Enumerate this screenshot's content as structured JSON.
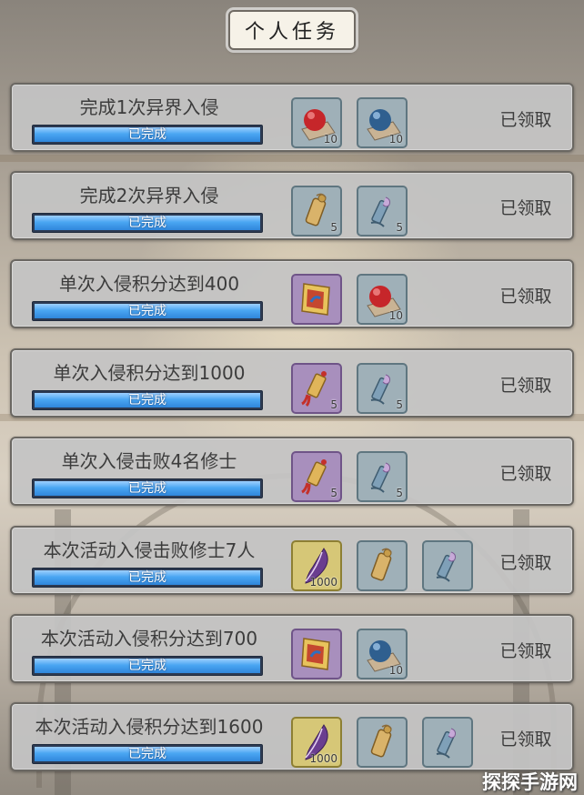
{
  "header": {
    "title": "个人任务"
  },
  "tasks": [
    {
      "title": "完成1次异界入侵",
      "progress_label": "已完成",
      "progress": 1.0,
      "status": "已领取",
      "rewards": [
        {
          "icon": "red-orb-icon",
          "count": "10",
          "bg": "blue"
        },
        {
          "icon": "blue-orb-icon",
          "count": "10",
          "bg": "blue"
        }
      ]
    },
    {
      "title": "完成2次异界入侵",
      "progress_label": "已完成",
      "progress": 1.0,
      "status": "已领取",
      "rewards": [
        {
          "icon": "scroll-icon",
          "count": "5",
          "bg": "blue"
        },
        {
          "icon": "ribbon-scroll-icon",
          "count": "5",
          "bg": "blue"
        }
      ]
    },
    {
      "title": "单次入侵积分达到400",
      "progress_label": "已完成",
      "progress": 1.0,
      "status": "已领取",
      "rewards": [
        {
          "icon": "banner-icon",
          "count": "",
          "bg": "purple"
        },
        {
          "icon": "red-orb-icon",
          "count": "10",
          "bg": "blue"
        }
      ]
    },
    {
      "title": "单次入侵积分达到1000",
      "progress_label": "已完成",
      "progress": 1.0,
      "status": "已领取",
      "rewards": [
        {
          "icon": "tassel-scroll-icon",
          "count": "5",
          "bg": "purple"
        },
        {
          "icon": "ribbon-scroll-icon",
          "count": "5",
          "bg": "blue"
        }
      ]
    },
    {
      "title": "单次入侵击败4名修士",
      "progress_label": "已完成",
      "progress": 1.0,
      "status": "已领取",
      "rewards": [
        {
          "icon": "tassel-scroll-icon",
          "count": "5",
          "bg": "purple"
        },
        {
          "icon": "ribbon-scroll-icon",
          "count": "5",
          "bg": "blue"
        }
      ]
    },
    {
      "title": "本次活动入侵击败修士7人",
      "progress_label": "已完成",
      "progress": 1.0,
      "status": "已领取",
      "rewards": [
        {
          "icon": "feather-icon",
          "count": "1000",
          "bg": "yellow"
        },
        {
          "icon": "scroll-icon",
          "count": "",
          "bg": "blue"
        },
        {
          "icon": "ribbon-scroll-icon",
          "count": "",
          "bg": "blue"
        }
      ]
    },
    {
      "title": "本次活动入侵积分达到700",
      "progress_label": "已完成",
      "progress": 1.0,
      "status": "已领取",
      "rewards": [
        {
          "icon": "banner-icon",
          "count": "",
          "bg": "purple"
        },
        {
          "icon": "blue-orb-icon",
          "count": "10",
          "bg": "blue"
        }
      ]
    },
    {
      "title": "本次活动入侵积分达到1600",
      "progress_label": "已完成",
      "progress": 1.0,
      "status": "已领取",
      "rewards": [
        {
          "icon": "feather-icon",
          "count": "1000",
          "bg": "yellow"
        },
        {
          "icon": "scroll-icon",
          "count": "",
          "bg": "blue"
        },
        {
          "icon": "ribbon-scroll-icon",
          "count": "",
          "bg": "blue"
        }
      ]
    }
  ],
  "watermark": {
    "text": "探探手游网"
  }
}
